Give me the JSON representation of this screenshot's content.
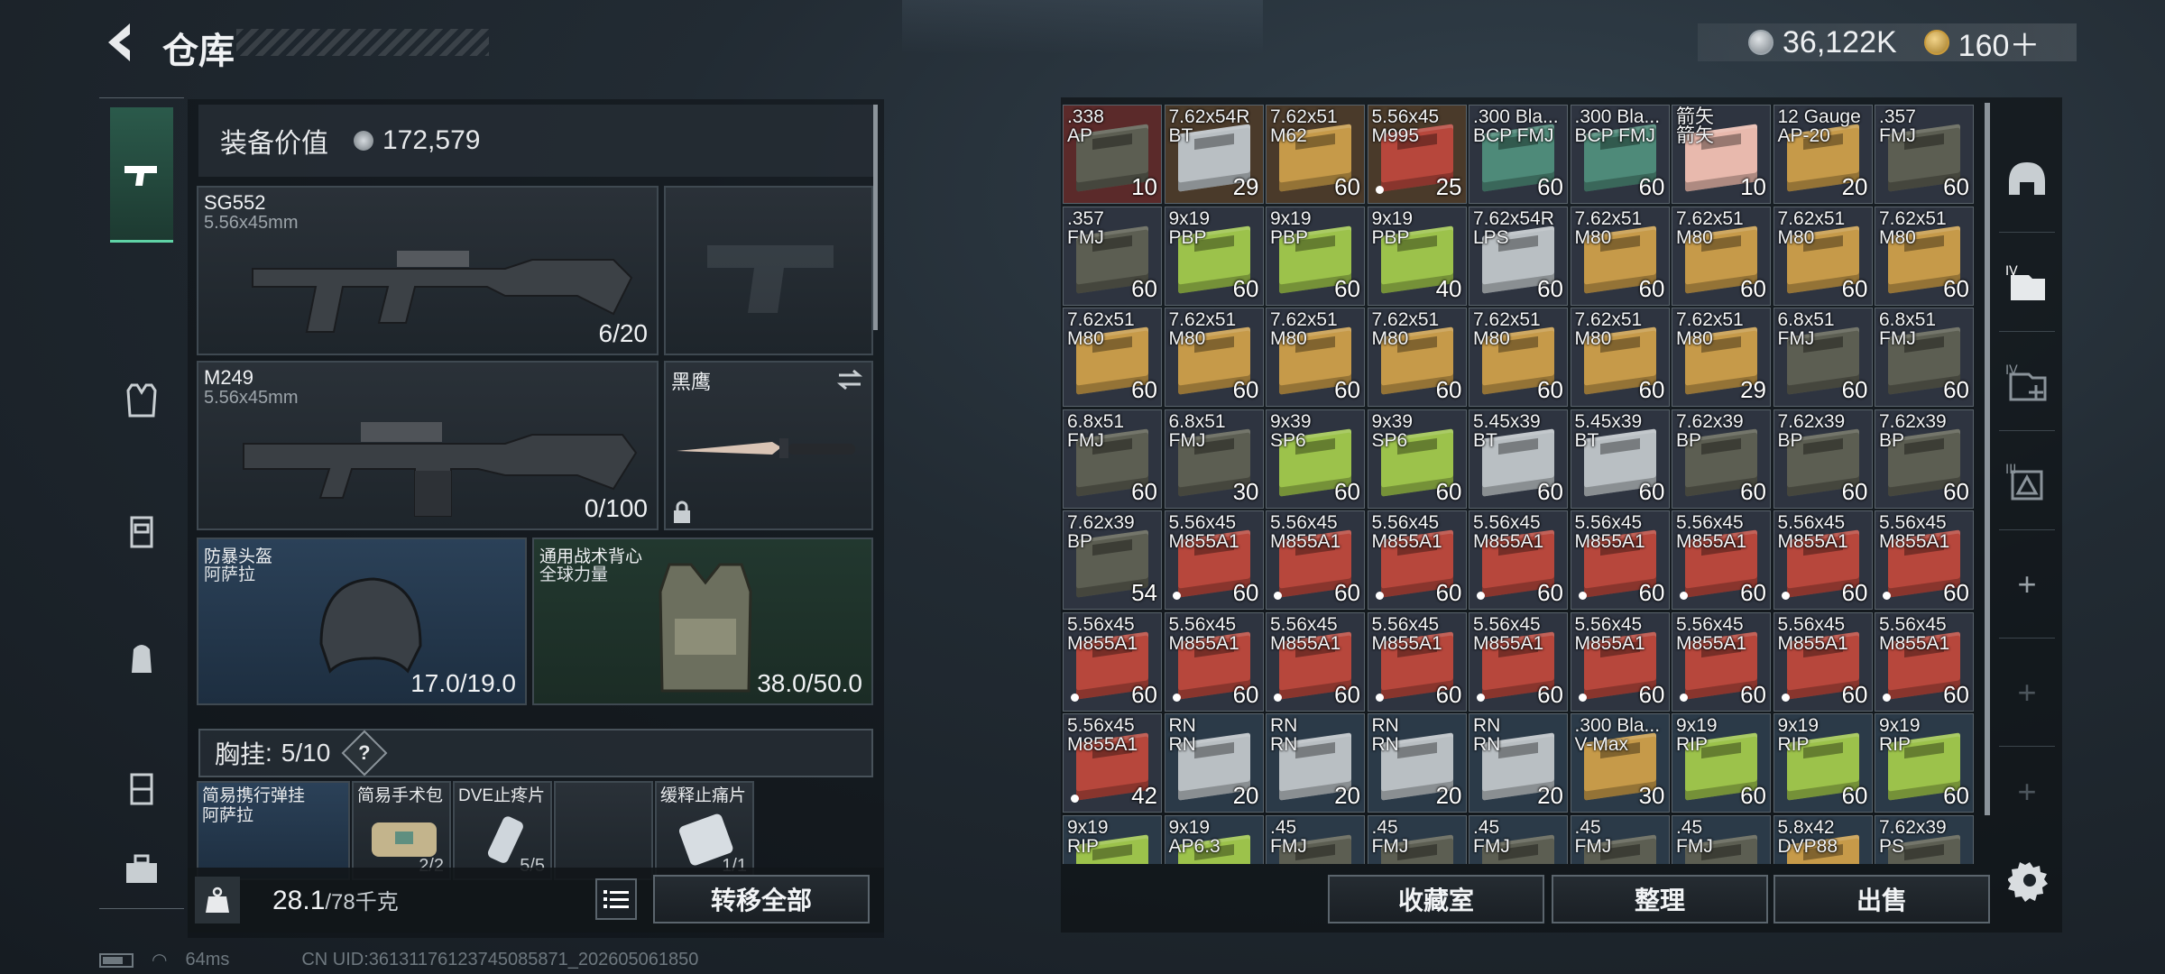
{
  "header": {
    "title": "仓库",
    "currency_silver": "36,122K",
    "currency_gold": "160＋"
  },
  "left": {
    "equip_value_label": "装备价值",
    "equip_value": "172,579",
    "primary": {
      "name": "SG552",
      "caliber": "5.56x45mm",
      "count": "6/20"
    },
    "secondary": {
      "name": "M249",
      "caliber": "5.56x45mm",
      "count": "0/100"
    },
    "melee": {
      "name": "黑鹰"
    },
    "helmet": {
      "name": "防暴头盔",
      "brand": "阿萨拉",
      "durability": "17.0/19.0"
    },
    "vest": {
      "name": "通用战术背心",
      "brand": "全球力量",
      "durability": "38.0/50.0"
    },
    "chest_label": "胸挂",
    "chest_count": "5/10",
    "chest_help": "?",
    "chest_items": [
      {
        "name": "简易携行弹挂\n阿萨拉",
        "count": ""
      },
      {
        "name": "简易手术包",
        "count": "2/2"
      },
      {
        "name": "DVE止疼片",
        "count": "5/5"
      },
      {
        "name": "",
        "count": ""
      },
      {
        "name": "缓释止痛片",
        "count": "1/1"
      }
    ],
    "weight": "28.1",
    "weight_max": "/78千克",
    "transfer_all": "转移全部"
  },
  "right_buttons": {
    "collection": "收藏室",
    "organize": "整理",
    "sell": "出售"
  },
  "status": {
    "ping": "64ms",
    "uid": "CN UID:36131176123745085871_202605061850"
  },
  "colors": {
    "accent": "#5fd3a6",
    "red_box": "#b7473c",
    "tan_box": "#c69a49",
    "green_box": "#9cc24b",
    "grey_box": "#b9bfc3",
    "dark_box": "#5c5e52",
    "teal_box": "#4e8a79",
    "pink_box": "#e8b9ad"
  },
  "inventory": [
    {
      "name": ".338\nAP",
      "count": "10",
      "box": "dark_box",
      "bg": "#5b2a2a"
    },
    {
      "name": "7.62x54R\nBT",
      "count": "29",
      "box": "grey_box",
      "bg": "#4a3a2a"
    },
    {
      "name": "7.62x51\nM62",
      "count": "60",
      "box": "tan_box",
      "bg": "#4a3a2a"
    },
    {
      "name": "5.56x45\nM995",
      "count": "25",
      "box": "red_box",
      "bg": "#4a3a2a",
      "dot": true
    },
    {
      "name": ".300 Bla...\nBCP FMJ",
      "count": "60",
      "box": "teal_box",
      "bg": "#2e3440"
    },
    {
      "name": ".300 Bla...\nBCP FMJ",
      "count": "60",
      "box": "teal_box",
      "bg": "#2e3440"
    },
    {
      "name": "箭矢\n箭矢",
      "count": "10",
      "box": "pink_box",
      "bg": "#2e3440"
    },
    {
      "name": "12 Gauge\nAP-20",
      "count": "20",
      "box": "tan_box",
      "bg": "#2e3440"
    },
    {
      "name": ".357\nFMJ",
      "count": "60",
      "box": "dark_box",
      "bg": "#2e3440"
    },
    {
      "name": ".357\nFMJ",
      "count": "60",
      "box": "dark_box",
      "bg": "#2e3440"
    },
    {
      "name": "9x19\nPBP",
      "count": "60",
      "box": "green_box",
      "bg": "#2e3440"
    },
    {
      "name": "9x19\nPBP",
      "count": "60",
      "box": "green_box",
      "bg": "#2e3440"
    },
    {
      "name": "9x19\nPBP",
      "count": "40",
      "box": "green_box",
      "bg": "#2e3440"
    },
    {
      "name": "7.62x54R\nLPS",
      "count": "60",
      "box": "grey_box",
      "bg": "#2e3440"
    },
    {
      "name": "7.62x51\nM80",
      "count": "60",
      "box": "tan_box",
      "bg": "#2e3440"
    },
    {
      "name": "7.62x51\nM80",
      "count": "60",
      "box": "tan_box",
      "bg": "#2e3440"
    },
    {
      "name": "7.62x51\nM80",
      "count": "60",
      "box": "tan_box",
      "bg": "#2e3440"
    },
    {
      "name": "7.62x51\nM80",
      "count": "60",
      "box": "tan_box",
      "bg": "#2e3440"
    },
    {
      "name": "7.62x51\nM80",
      "count": "60",
      "box": "tan_box",
      "bg": "#2e3440"
    },
    {
      "name": "7.62x51\nM80",
      "count": "60",
      "box": "tan_box",
      "bg": "#2e3440"
    },
    {
      "name": "7.62x51\nM80",
      "count": "60",
      "box": "tan_box",
      "bg": "#2e3440"
    },
    {
      "name": "7.62x51\nM80",
      "count": "60",
      "box": "tan_box",
      "bg": "#2e3440"
    },
    {
      "name": "7.62x51\nM80",
      "count": "60",
      "box": "tan_box",
      "bg": "#2e3440"
    },
    {
      "name": "7.62x51\nM80",
      "count": "60",
      "box": "tan_box",
      "bg": "#2e3440"
    },
    {
      "name": "7.62x51\nM80",
      "count": "29",
      "box": "tan_box",
      "bg": "#2e3440"
    },
    {
      "name": "6.8x51\nFMJ",
      "count": "60",
      "box": "dark_box",
      "bg": "#2e3440"
    },
    {
      "name": "6.8x51\nFMJ",
      "count": "60",
      "box": "dark_box",
      "bg": "#2e3440"
    },
    {
      "name": "6.8x51\nFMJ",
      "count": "60",
      "box": "dark_box",
      "bg": "#2e3440"
    },
    {
      "name": "6.8x51\nFMJ",
      "count": "30",
      "box": "dark_box",
      "bg": "#2e3440"
    },
    {
      "name": "9x39\nSP6",
      "count": "60",
      "box": "green_box",
      "bg": "#2e3440"
    },
    {
      "name": "9x39\nSP6",
      "count": "60",
      "box": "green_box",
      "bg": "#2e3440"
    },
    {
      "name": "5.45x39\nBT",
      "count": "60",
      "box": "grey_box",
      "bg": "#2e3440"
    },
    {
      "name": "5.45x39\nBT",
      "count": "60",
      "box": "grey_box",
      "bg": "#2e3440"
    },
    {
      "name": "7.62x39\nBP",
      "count": "60",
      "box": "dark_box",
      "bg": "#2e3440"
    },
    {
      "name": "7.62x39\nBP",
      "count": "60",
      "box": "dark_box",
      "bg": "#2e3440"
    },
    {
      "name": "7.62x39\nBP",
      "count": "60",
      "box": "dark_box",
      "bg": "#2e3440"
    },
    {
      "name": "7.62x39\nBP",
      "count": "54",
      "box": "dark_box",
      "bg": "#2e3440"
    },
    {
      "name": "5.56x45\nM855A1",
      "count": "60",
      "box": "red_box",
      "bg": "#2e3440",
      "dot": true
    },
    {
      "name": "5.56x45\nM855A1",
      "count": "60",
      "box": "red_box",
      "bg": "#2e3440",
      "dot": true
    },
    {
      "name": "5.56x45\nM855A1",
      "count": "60",
      "box": "red_box",
      "bg": "#2e3440",
      "dot": true
    },
    {
      "name": "5.56x45\nM855A1",
      "count": "60",
      "box": "red_box",
      "bg": "#2e3440",
      "dot": true
    },
    {
      "name": "5.56x45\nM855A1",
      "count": "60",
      "box": "red_box",
      "bg": "#2e3440",
      "dot": true
    },
    {
      "name": "5.56x45\nM855A1",
      "count": "60",
      "box": "red_box",
      "bg": "#2e3440",
      "dot": true
    },
    {
      "name": "5.56x45\nM855A1",
      "count": "60",
      "box": "red_box",
      "bg": "#2e3440",
      "dot": true
    },
    {
      "name": "5.56x45\nM855A1",
      "count": "60",
      "box": "red_box",
      "bg": "#2e3440",
      "dot": true
    },
    {
      "name": "5.56x45\nM855A1",
      "count": "60",
      "box": "red_box",
      "bg": "#2e3440",
      "dot": true
    },
    {
      "name": "5.56x45\nM855A1",
      "count": "60",
      "box": "red_box",
      "bg": "#2e3440",
      "dot": true
    },
    {
      "name": "5.56x45\nM855A1",
      "count": "60",
      "box": "red_box",
      "bg": "#2e3440",
      "dot": true
    },
    {
      "name": "5.56x45\nM855A1",
      "count": "60",
      "box": "red_box",
      "bg": "#2e3440",
      "dot": true
    },
    {
      "name": "5.56x45\nM855A1",
      "count": "60",
      "box": "red_box",
      "bg": "#2e3440",
      "dot": true
    },
    {
      "name": "5.56x45\nM855A1",
      "count": "60",
      "box": "red_box",
      "bg": "#2e3440",
      "dot": true
    },
    {
      "name": "5.56x45\nM855A1",
      "count": "60",
      "box": "red_box",
      "bg": "#2e3440",
      "dot": true
    },
    {
      "name": "5.56x45\nM855A1",
      "count": "60",
      "box": "red_box",
      "bg": "#2e3440",
      "dot": true
    },
    {
      "name": "5.56x45\nM855A1",
      "count": "60",
      "box": "red_box",
      "bg": "#2e3440",
      "dot": true
    },
    {
      "name": "5.56x45\nM855A1",
      "count": "42",
      "box": "red_box",
      "bg": "#2e3440",
      "dot": true
    },
    {
      "name": "RN\nRN",
      "count": "20",
      "box": "grey_box",
      "bg": "#2b3a48"
    },
    {
      "name": "RN\nRN",
      "count": "20",
      "box": "grey_box",
      "bg": "#2b3a48"
    },
    {
      "name": "RN\nRN",
      "count": "20",
      "box": "grey_box",
      "bg": "#2b3a48"
    },
    {
      "name": "RN\nRN",
      "count": "20",
      "box": "grey_box",
      "bg": "#2b3a48"
    },
    {
      "name": ".300 Bla...\nV-Max",
      "count": "30",
      "box": "tan_box",
      "bg": "#2b3a48"
    },
    {
      "name": "9x19\nRIP",
      "count": "60",
      "box": "green_box",
      "bg": "#2b3a48"
    },
    {
      "name": "9x19\nRIP",
      "count": "60",
      "box": "green_box",
      "bg": "#2b3a48"
    },
    {
      "name": "9x19\nRIP",
      "count": "60",
      "box": "green_box",
      "bg": "#2b3a48"
    },
    {
      "name": "9x19\nRIP",
      "count": "",
      "box": "green_box",
      "bg": "#2b3a48"
    },
    {
      "name": "9x19\nAP6.3",
      "count": "",
      "box": "green_box",
      "bg": "#2b3a48"
    },
    {
      "name": ".45\nFMJ",
      "count": "",
      "box": "dark_box",
      "bg": "#2b3a48"
    },
    {
      "name": ".45\nFMJ",
      "count": "",
      "box": "dark_box",
      "bg": "#2b3a48"
    },
    {
      "name": ".45\nFMJ",
      "count": "",
      "box": "dark_box",
      "bg": "#2b3a48"
    },
    {
      "name": ".45\nFMJ",
      "count": "",
      "box": "dark_box",
      "bg": "#2b3a48"
    },
    {
      "name": ".45\nFMJ",
      "count": "",
      "box": "dark_box",
      "bg": "#2b3a48"
    },
    {
      "name": "5.8x42\nDVP88",
      "count": "",
      "box": "tan_box",
      "bg": "#2b3a48"
    },
    {
      "name": "7.62x39\nPS",
      "count": "",
      "box": "dark_box",
      "bg": "#2b3a48"
    }
  ]
}
